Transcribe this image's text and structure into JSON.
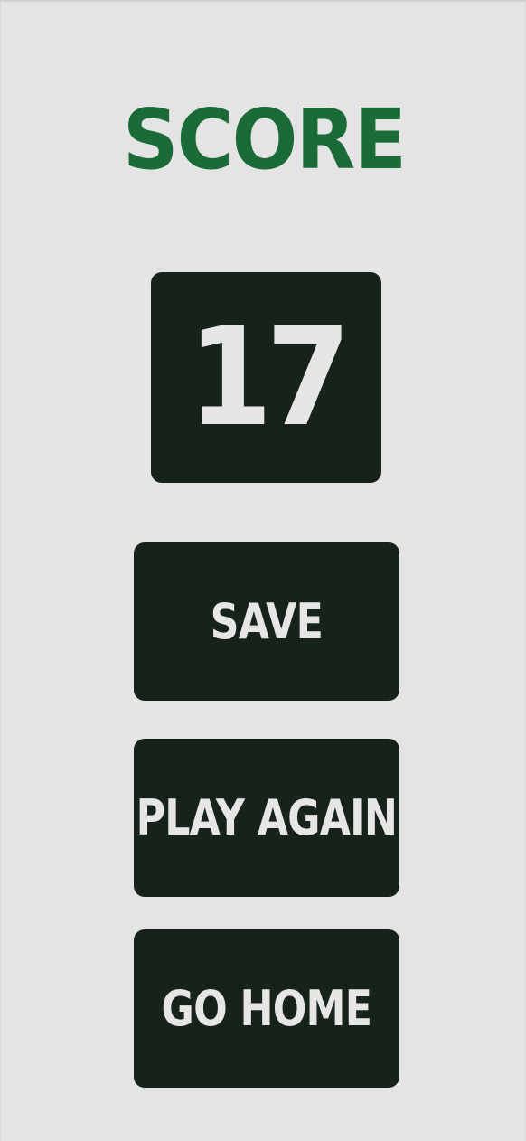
{
  "title": "SCORE",
  "score": "17",
  "buttons": {
    "save": "SAVE",
    "play_again": "PLAY AGAIN",
    "go_home": "GO HOME"
  },
  "colors": {
    "background": "#e4e4e4",
    "title": "#1b6b38",
    "panel": "#17231a",
    "panel_text": "#e6e6e6"
  }
}
